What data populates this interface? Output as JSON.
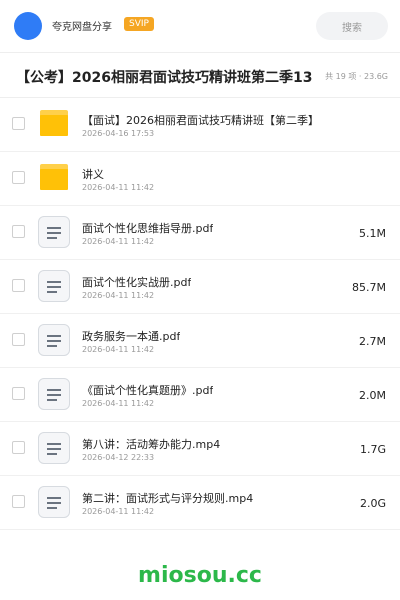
{
  "header": {
    "share_name": "夸克网盘分享",
    "badge": "SVIP",
    "search_label": "搜索"
  },
  "title_bar": {
    "title": "【公考】2026相丽君面试技巧精讲班第二季13",
    "meta": "共 19 项 · 23.6G"
  },
  "files": [
    {
      "type": "folder",
      "name": "【面试】2026相丽君面试技巧精讲班【第二季】",
      "date": "2026-04-16 17:53",
      "size": ""
    },
    {
      "type": "folder",
      "name": "讲义",
      "date": "2026-04-11 11:42",
      "size": ""
    },
    {
      "type": "file",
      "name": "面试个性化思维指导册.pdf",
      "date": "2026-04-11 11:42",
      "size": "5.1M"
    },
    {
      "type": "file",
      "name": "面试个性化实战册.pdf",
      "date": "2026-04-11 11:42",
      "size": "85.7M"
    },
    {
      "type": "file",
      "name": "政务服务一本通.pdf",
      "date": "2026-04-11 11:42",
      "size": "2.7M"
    },
    {
      "type": "file",
      "name": "《面试个性化真题册》.pdf",
      "date": "2026-04-11 11:42",
      "size": "2.0M"
    },
    {
      "type": "file",
      "name": "第八讲：活动筹办能力.mp4",
      "date": "2026-04-12 22:33",
      "size": "1.7G"
    },
    {
      "type": "file",
      "name": "第二讲：面试形式与评分规则.mp4",
      "date": "2026-04-11 11:42",
      "size": "2.0G"
    }
  ],
  "footer": {
    "brand": "miosou.cc"
  }
}
